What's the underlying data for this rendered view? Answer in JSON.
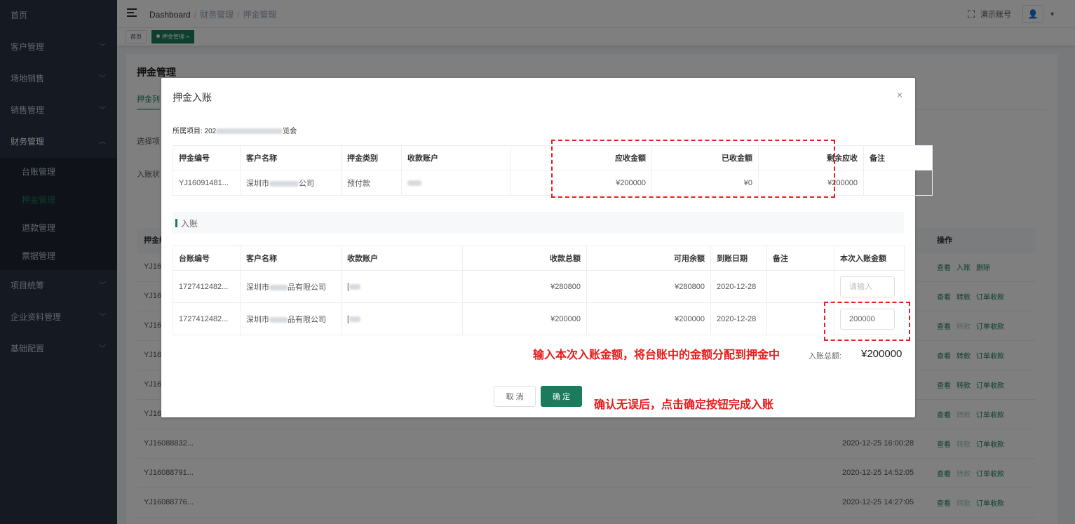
{
  "sidebar": {
    "items": [
      {
        "label": "首页",
        "chevron": false
      },
      {
        "label": "客户管理",
        "chevron": true
      },
      {
        "label": "场地销售",
        "chevron": true
      },
      {
        "label": "销售管理",
        "chevron": true
      },
      {
        "label": "财务管理",
        "chevron": true,
        "expanded": true
      }
    ],
    "sub_items": [
      "台账管理",
      "押金管理",
      "退款管理",
      "票据管理"
    ],
    "items_after": [
      "项目统筹",
      "企业资料管理",
      "基础配置"
    ]
  },
  "header": {
    "breadcrumb": [
      "Dashboard",
      "财务管理",
      "押金管理"
    ],
    "account": "演示账号"
  },
  "tags": {
    "home": "首页",
    "active": "押金管理",
    "close": "×"
  },
  "page": {
    "title": "押金管理",
    "tab": "押金列",
    "filter1": "选择项",
    "filter2": "入账状"
  },
  "bg_table": {
    "head1": "押金编",
    "ops_head": "操作",
    "rows": [
      {
        "id": "YJ16",
        "time": "",
        "ops": [
          "查看",
          "入账",
          "删除"
        ],
        "disabled": []
      },
      {
        "id": "YJ16",
        "time": "",
        "ops": [
          "查看",
          "转款",
          "订单收款"
        ],
        "disabled": []
      },
      {
        "id": "YJ16",
        "time": "",
        "ops": [
          "查看",
          "转款",
          "订单收款"
        ],
        "disabled": [
          1
        ]
      },
      {
        "id": "YJ16",
        "time": "",
        "ops": [
          "查看",
          "转款",
          "订单收款"
        ],
        "disabled": []
      },
      {
        "id": "YJ16",
        "time": "",
        "ops": [
          "查看",
          "转款",
          "订单收款"
        ],
        "disabled": []
      },
      {
        "id": "YJ16",
        "time": "",
        "ops": [
          "查看",
          "转款",
          "订单收款"
        ],
        "disabled": [
          1
        ]
      },
      {
        "id": "YJ16088832...",
        "time": "2020-12-25 16:00:28",
        "ops": [
          "查看",
          "转款",
          "订单收款"
        ],
        "disabled": [
          1
        ]
      },
      {
        "id": "YJ16088791...",
        "time": "2020-12-25 14:52:05",
        "ops": [
          "查看",
          "转款",
          "订单收款"
        ],
        "disabled": [
          1
        ]
      },
      {
        "id": "YJ16088776...",
        "time": "2020-12-25 14:27:05",
        "ops": [
          "查看",
          "转款",
          "订单收款"
        ],
        "disabled": [
          1
        ]
      }
    ]
  },
  "dialog": {
    "title": "押金入账",
    "close": "×",
    "project_label": "所属项目:",
    "project_prefix": "202",
    "project_suffix": "览会",
    "deposit_table": {
      "headers": [
        "押金编号",
        "客户名称",
        "押金类别",
        "收款账户",
        "",
        "应收金额",
        "已收金额",
        "剩余应收",
        "备注"
      ],
      "row": {
        "id": "YJ16091481...",
        "customer_prefix": "深圳市",
        "customer_suffix": "公司",
        "type": "预付款",
        "receivable": "¥200000",
        "received": "¥0",
        "remaining": "¥200000",
        "remark": ""
      }
    },
    "section_title": "入账",
    "ledger_table": {
      "headers": [
        "台账编号",
        "客户名称",
        "收款账户",
        "收款总额",
        "可用余额",
        "到账日期",
        "备注",
        "本次入账金额"
      ],
      "rows": [
        {
          "id": "1727412482...",
          "customer_prefix": "深圳市",
          "customer_suffix": "品有限公司",
          "account_prefix": "[",
          "total": "¥280800",
          "available": "¥280800",
          "date": "2020-12-28",
          "remark": "",
          "input_value": "",
          "input_placeholder": "请输入"
        },
        {
          "id": "1727412482...",
          "customer_prefix": "深圳市",
          "customer_suffix": "品有限公司",
          "account_prefix": "[",
          "total": "¥200000",
          "available": "¥200000",
          "date": "2020-12-28",
          "remark": "",
          "input_value": "200000",
          "input_placeholder": "请输入"
        }
      ]
    },
    "annotation_1": "输入本次入账金额，将台账中的金额分配到押金中",
    "annotation_2": "确认无误后，点击确定按钮完成入账",
    "total_label": "入账总额:",
    "total_value": "¥200000",
    "cancel_label": "取 消",
    "ok_label": "确 定"
  },
  "colors": {
    "brand": "#1a7c5c",
    "sidebar": "#2b3544",
    "annotation": "#e51c1c"
  }
}
